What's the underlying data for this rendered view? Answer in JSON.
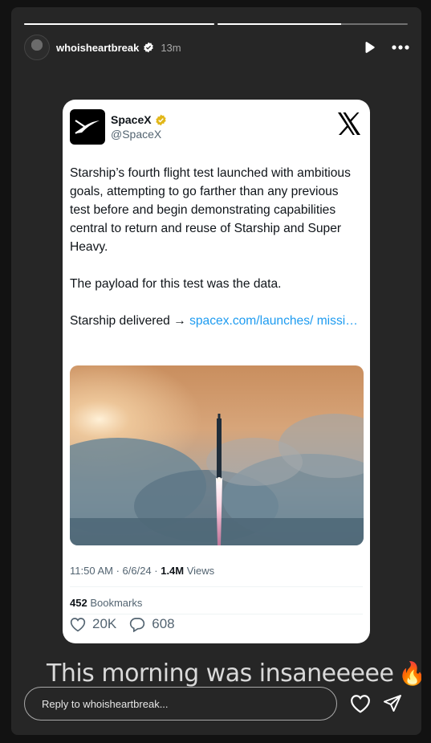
{
  "story": {
    "username": "whoisheartbreak",
    "time_ago": "13m",
    "progress": [
      1.0,
      0.65
    ],
    "caption": "This morning was insaneeeee",
    "caption_emojis": "🔥🚀"
  },
  "tweet": {
    "name": "SpaceX",
    "handle": "@SpaceX",
    "paragraph1": "Starship’s fourth flight test launched with ambitious goals, attempting to go farther than any previous test before and begin demonstrating capabilities central to return and reuse of Starship and Super Heavy.",
    "paragraph2": "The payload for this test was the data.",
    "delivered_prefix": "Starship delivered → ",
    "link_text": "spacex.com/launches/ missi…",
    "time": "11:50 AM · 6/6/24 · ",
    "views_count": "1.4M",
    "views_label": " Views",
    "bookmarks_count": "452",
    "bookmarks_label": " Bookmarks",
    "likes": "20K",
    "replies": "608"
  },
  "reply": {
    "placeholder": "Reply to whoisheartbreak..."
  },
  "colors": {
    "background": "#262626",
    "link": "#1d9bf0",
    "verified": "#e2b719"
  },
  "icons": [
    "verified-badge-icon",
    "play-icon",
    "more-icon",
    "x-logo-icon",
    "spacex-logo-icon",
    "heart-icon",
    "reply-bubble-icon",
    "send-icon"
  ]
}
